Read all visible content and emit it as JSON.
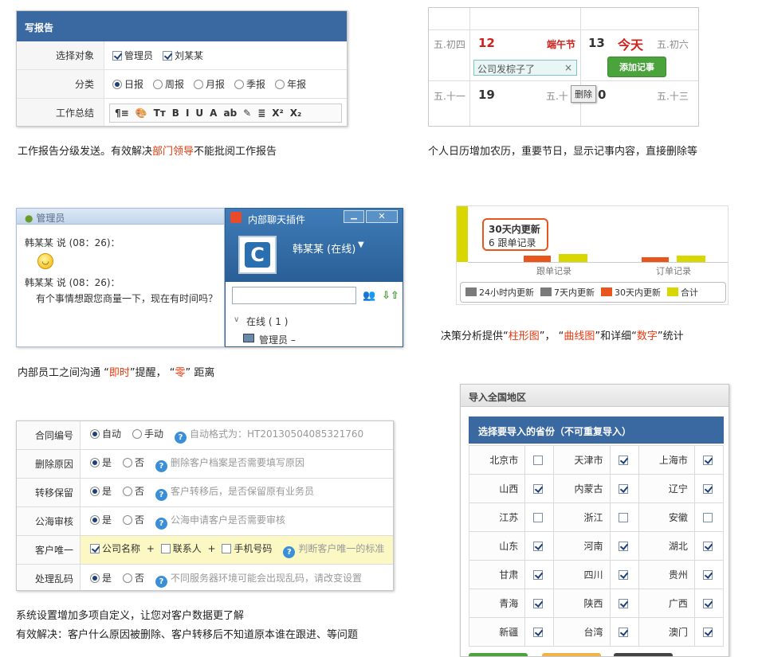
{
  "report": {
    "title": "写报告",
    "target_label": "选择对象",
    "targets": [
      {
        "label": "管理员",
        "checked": true
      },
      {
        "label": "刘某某",
        "checked": true
      }
    ],
    "category_label": "分类",
    "categories": [
      {
        "label": "日报",
        "on": true
      },
      {
        "label": "周报",
        "on": false
      },
      {
        "label": "月报",
        "on": false
      },
      {
        "label": "季报",
        "on": false
      },
      {
        "label": "年报",
        "on": false
      }
    ],
    "summary_label": "工作总结",
    "toolbar": [
      "¶≡",
      "🎨",
      "Tт",
      "B",
      "I",
      "U",
      "A",
      "ab",
      "✎",
      "≣",
      "X²",
      "X₂"
    ]
  },
  "caption1": {
    "a": "工作报告分级发送。有效解决",
    "b": "部门领导",
    "c": "不能批阅工作报告"
  },
  "calendar": {
    "lunar1": "五.初四",
    "day1": "12",
    "festival": "端午节",
    "day2": "13",
    "today": "今天",
    "lunar2": "五.初六",
    "event": "公司发棕子了",
    "event_close": "×",
    "add_button": "添加记事",
    "lunar3": "五.十一",
    "day3": "19",
    "lunar4": "五.十",
    "delete_tip": "删除",
    "day4": "0",
    "lunar5": "五.十三"
  },
  "caption2": "个人日历增加农历，重要节日，显示记事内容，直接删除等",
  "chat": {
    "left_title": "管理员",
    "msg1_head": "韩某某 说 (08：26)：",
    "msg2_head": "韩某某 说 (08：26)：",
    "msg2_body": "有个事情想跟您商量一下，现在有时间吗？",
    "right_title": "内部聊天插件",
    "user": "韩某某 (在线)",
    "online": "在线 ( 1 )",
    "member": "管理员 –"
  },
  "caption3": {
    "a": "内部员工之间沟通 “",
    "b": "即时",
    "c": "”提醒， “",
    "d": "零",
    "e": "” 距离"
  },
  "chart": {
    "tooltip_title": "30天内更新",
    "tooltip_value": "6 跟单记录",
    "axis1": "跟单记录",
    "axis2": "订单记录",
    "legend": [
      {
        "label": "24小时内更新",
        "color": "#7a7a7a"
      },
      {
        "label": "7天内更新",
        "color": "#7a7a7a"
      },
      {
        "label": "30天内更新",
        "color": "#e8561e"
      },
      {
        "label": "合计",
        "color": "#d8d800"
      }
    ]
  },
  "caption4": {
    "a": "决策分析提供“",
    "b": "柱形图",
    "c": "”， “",
    "d": "曲线图",
    "e": "”和详细“",
    "f": "数字",
    "g": "”统计"
  },
  "settings": [
    {
      "label": "合同编号",
      "opts": [
        {
          "t": "自动",
          "on": true
        },
        {
          "t": "手动",
          "on": false
        }
      ],
      "hint": "自动格式为：HT20130504085321760"
    },
    {
      "label": "删除原因",
      "opts": [
        {
          "t": "是",
          "on": true
        },
        {
          "t": "否",
          "on": false
        }
      ],
      "hint": "删除客户档案是否需要填写原因"
    },
    {
      "label": "转移保留",
      "opts": [
        {
          "t": "是",
          "on": true
        },
        {
          "t": "否",
          "on": false
        }
      ],
      "hint": "客户转移后，是否保留原有业务员"
    },
    {
      "label": "公海审核",
      "opts": [
        {
          "t": "是",
          "on": true
        },
        {
          "t": "否",
          "on": false
        }
      ],
      "hint": "公海申请客户是否需要审核"
    },
    {
      "label": "客户唯一",
      "checks": [
        {
          "t": "公司名称",
          "on": true
        },
        {
          "t": "联系人",
          "on": false
        },
        {
          "t": "手机号码",
          "on": false
        }
      ],
      "hint": "判断客户唯一的标准"
    },
    {
      "label": "处理乱码",
      "opts": [
        {
          "t": "是",
          "on": true
        },
        {
          "t": "否",
          "on": false
        }
      ],
      "hint": "不同服务器环境可能会出现乱码，请改变设置"
    }
  ],
  "caption5": "系统设置增加多项自定义，让您对客户数据更了解",
  "caption6": "有效解决：客户什么原因被删除、客户转移后不知道原本谁在跟进、等问题",
  "region": {
    "title": "导入全国地区",
    "header": "选择要导入的省份（不可重复导入）",
    "rows": [
      [
        {
          "n": "北京市",
          "c": false
        },
        {
          "n": "天津市",
          "c": true
        },
        {
          "n": "上海市",
          "c": true
        }
      ],
      [
        {
          "n": "山西",
          "c": true
        },
        {
          "n": "内蒙古",
          "c": true
        },
        {
          "n": "辽宁",
          "c": true
        }
      ],
      [
        {
          "n": "江苏",
          "c": false
        },
        {
          "n": "浙江",
          "c": false
        },
        {
          "n": "安徽",
          "c": false
        }
      ],
      [
        {
          "n": "山东",
          "c": true
        },
        {
          "n": "河南",
          "c": true
        },
        {
          "n": "湖北",
          "c": true
        }
      ],
      [
        {
          "n": "甘肃",
          "c": true
        },
        {
          "n": "四川",
          "c": true
        },
        {
          "n": "贵州",
          "c": true
        }
      ],
      [
        {
          "n": "青海",
          "c": true
        },
        {
          "n": "陕西",
          "c": true
        },
        {
          "n": "广西",
          "c": true
        }
      ],
      [
        {
          "n": "新疆",
          "c": true
        },
        {
          "n": "台湾",
          "c": true
        },
        {
          "n": "澳门",
          "c": true
        }
      ]
    ]
  }
}
